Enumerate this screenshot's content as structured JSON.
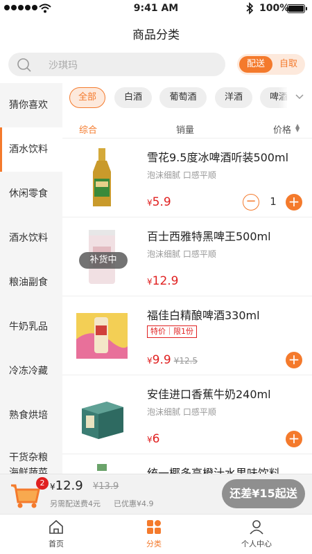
{
  "status_bar": {
    "time": "9:41 AM",
    "battery": "100%"
  },
  "page_title": "商品分类",
  "search": {
    "placeholder": "沙琪玛"
  },
  "mode_toggle": {
    "selected": "配送",
    "other": "自取"
  },
  "sidebar": {
    "items": [
      {
        "label": "猜你喜欢"
      },
      {
        "label": "酒水饮料",
        "active": true
      },
      {
        "label": "休闲零食"
      },
      {
        "label": "酒水饮料"
      },
      {
        "label": "粮油副食"
      },
      {
        "label": "牛奶乳品"
      },
      {
        "label": "冷冻冷藏"
      },
      {
        "label": "熟食烘培"
      },
      {
        "label": "干货杂粮",
        "line2": "海鲜蔬菜"
      }
    ]
  },
  "filters": {
    "chips": [
      {
        "label": "全部",
        "active": true
      },
      {
        "label": "白酒"
      },
      {
        "label": "葡萄酒"
      },
      {
        "label": "洋酒"
      },
      {
        "label": "啤酒"
      }
    ]
  },
  "sort": {
    "comprehensive": "综合",
    "sales": "销量",
    "price": "价格"
  },
  "products": [
    {
      "name": "雪花9.5度冰啤酒听装500ml",
      "desc": "泡沫细腻 口感平顺",
      "currency": "¥",
      "price": "5.9",
      "quantity": "1"
    },
    {
      "name": "百士西雅特黑啤王500ml",
      "desc": "泡沫细腻 口感平顺",
      "currency": "¥",
      "price": "12.9",
      "status": "补货中"
    },
    {
      "name": "福佳白精酿啤酒330ml",
      "tag": "特价｜限1份",
      "currency": "¥",
      "price": "9.9",
      "original_price": "¥12.5"
    },
    {
      "name": "安佳进口香蕉牛奶240ml",
      "desc": "泡沫细腻 口感平顺",
      "currency": "¥",
      "price": "6"
    },
    {
      "name": "统一椰多高橙汁水果味饮料"
    }
  ],
  "cart": {
    "count": "2",
    "currency": "¥",
    "total": "12.9",
    "original_total": "¥13.9",
    "delivery_note": "另需配送费4元",
    "discount_note": "已优惠¥4.9",
    "checkout_label": "还差¥15起送"
  },
  "tab_bar": {
    "home": "首页",
    "category": "分类",
    "profile": "个人中心"
  },
  "colors": {
    "accent": "#f47a2c",
    "price": "#e02020"
  }
}
